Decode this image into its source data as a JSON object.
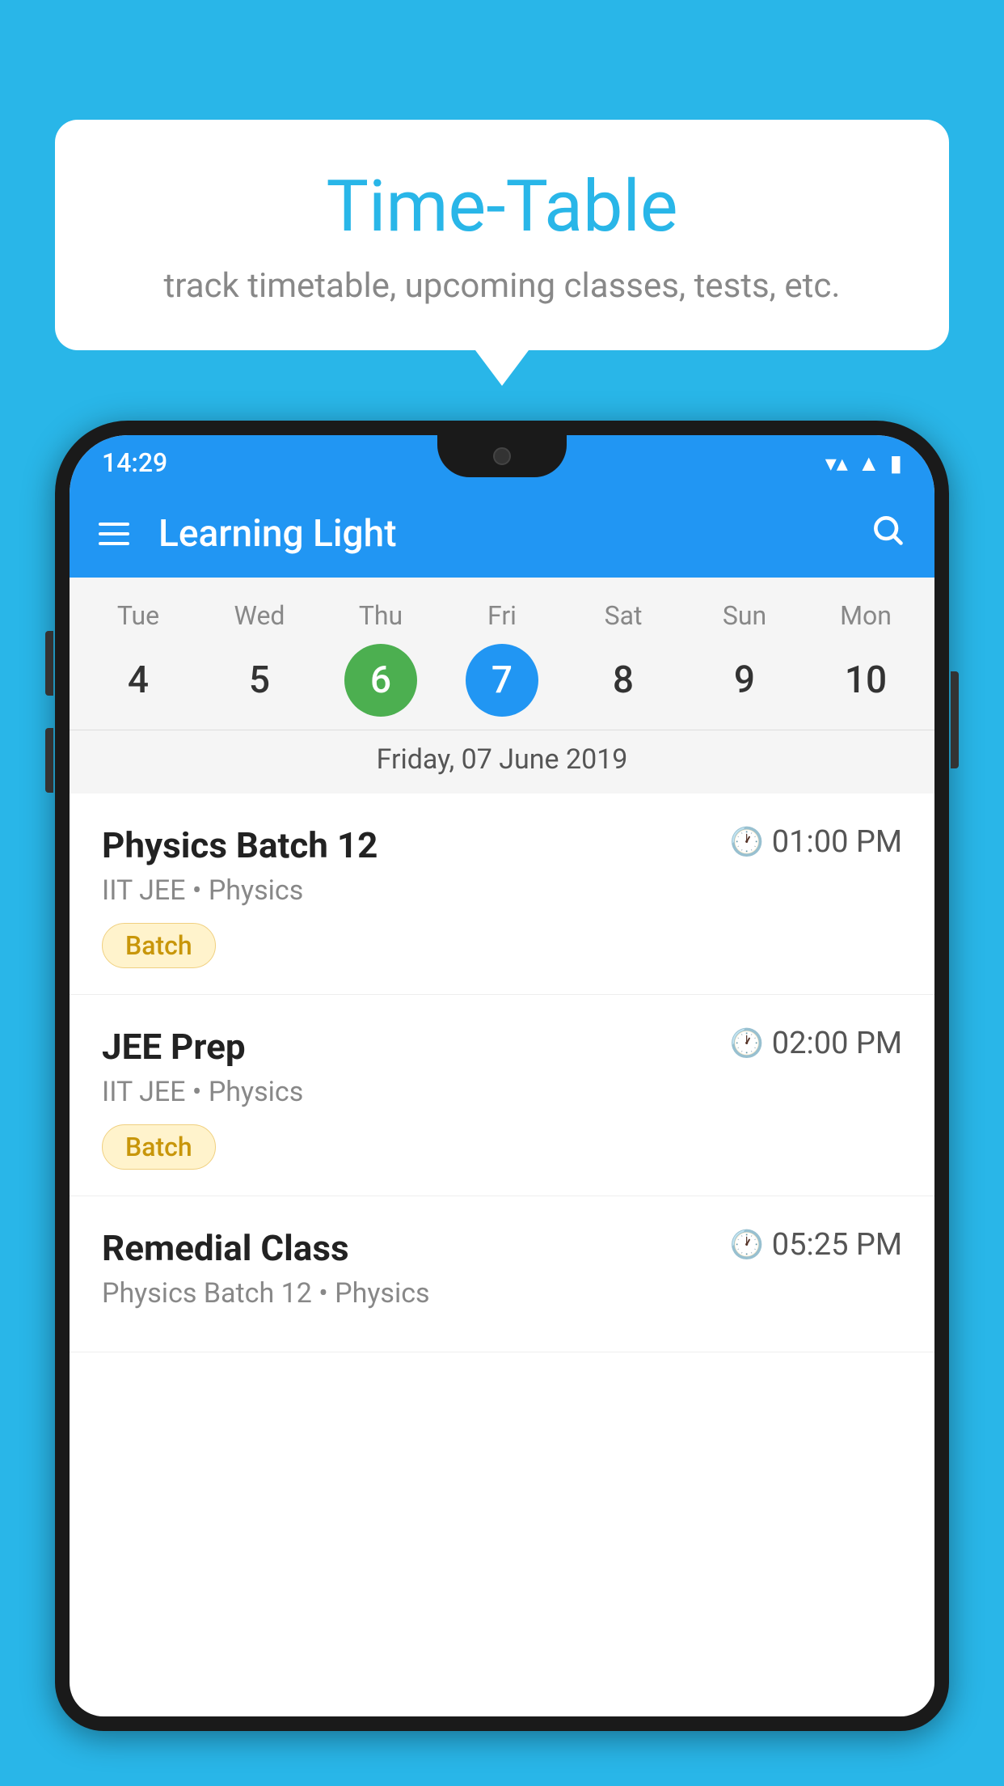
{
  "background_color": "#29B6E8",
  "card": {
    "title": "Time-Table",
    "subtitle": "track timetable, upcoming classes, tests, etc."
  },
  "status_bar": {
    "time": "14:29",
    "wifi_icon": "▼▲",
    "signal_icon": "▲",
    "battery_icon": "▮"
  },
  "app_header": {
    "title": "Learning Light",
    "search_label": "search"
  },
  "calendar": {
    "days": [
      {
        "name": "Tue",
        "num": "4",
        "state": "normal"
      },
      {
        "name": "Wed",
        "num": "5",
        "state": "normal"
      },
      {
        "name": "Thu",
        "num": "6",
        "state": "today"
      },
      {
        "name": "Fri",
        "num": "7",
        "state": "selected"
      },
      {
        "name": "Sat",
        "num": "8",
        "state": "normal"
      },
      {
        "name": "Sun",
        "num": "9",
        "state": "normal"
      },
      {
        "name": "Mon",
        "num": "10",
        "state": "normal"
      }
    ],
    "selected_date_label": "Friday, 07 June 2019"
  },
  "classes": [
    {
      "name": "Physics Batch 12",
      "time": "01:00 PM",
      "meta": "IIT JEE • Physics",
      "tag": "Batch"
    },
    {
      "name": "JEE Prep",
      "time": "02:00 PM",
      "meta": "IIT JEE • Physics",
      "tag": "Batch"
    },
    {
      "name": "Remedial Class",
      "time": "05:25 PM",
      "meta": "Physics Batch 12 • Physics",
      "tag": ""
    }
  ],
  "icons": {
    "hamburger": "menu",
    "search": "🔍",
    "clock": "🕐"
  }
}
